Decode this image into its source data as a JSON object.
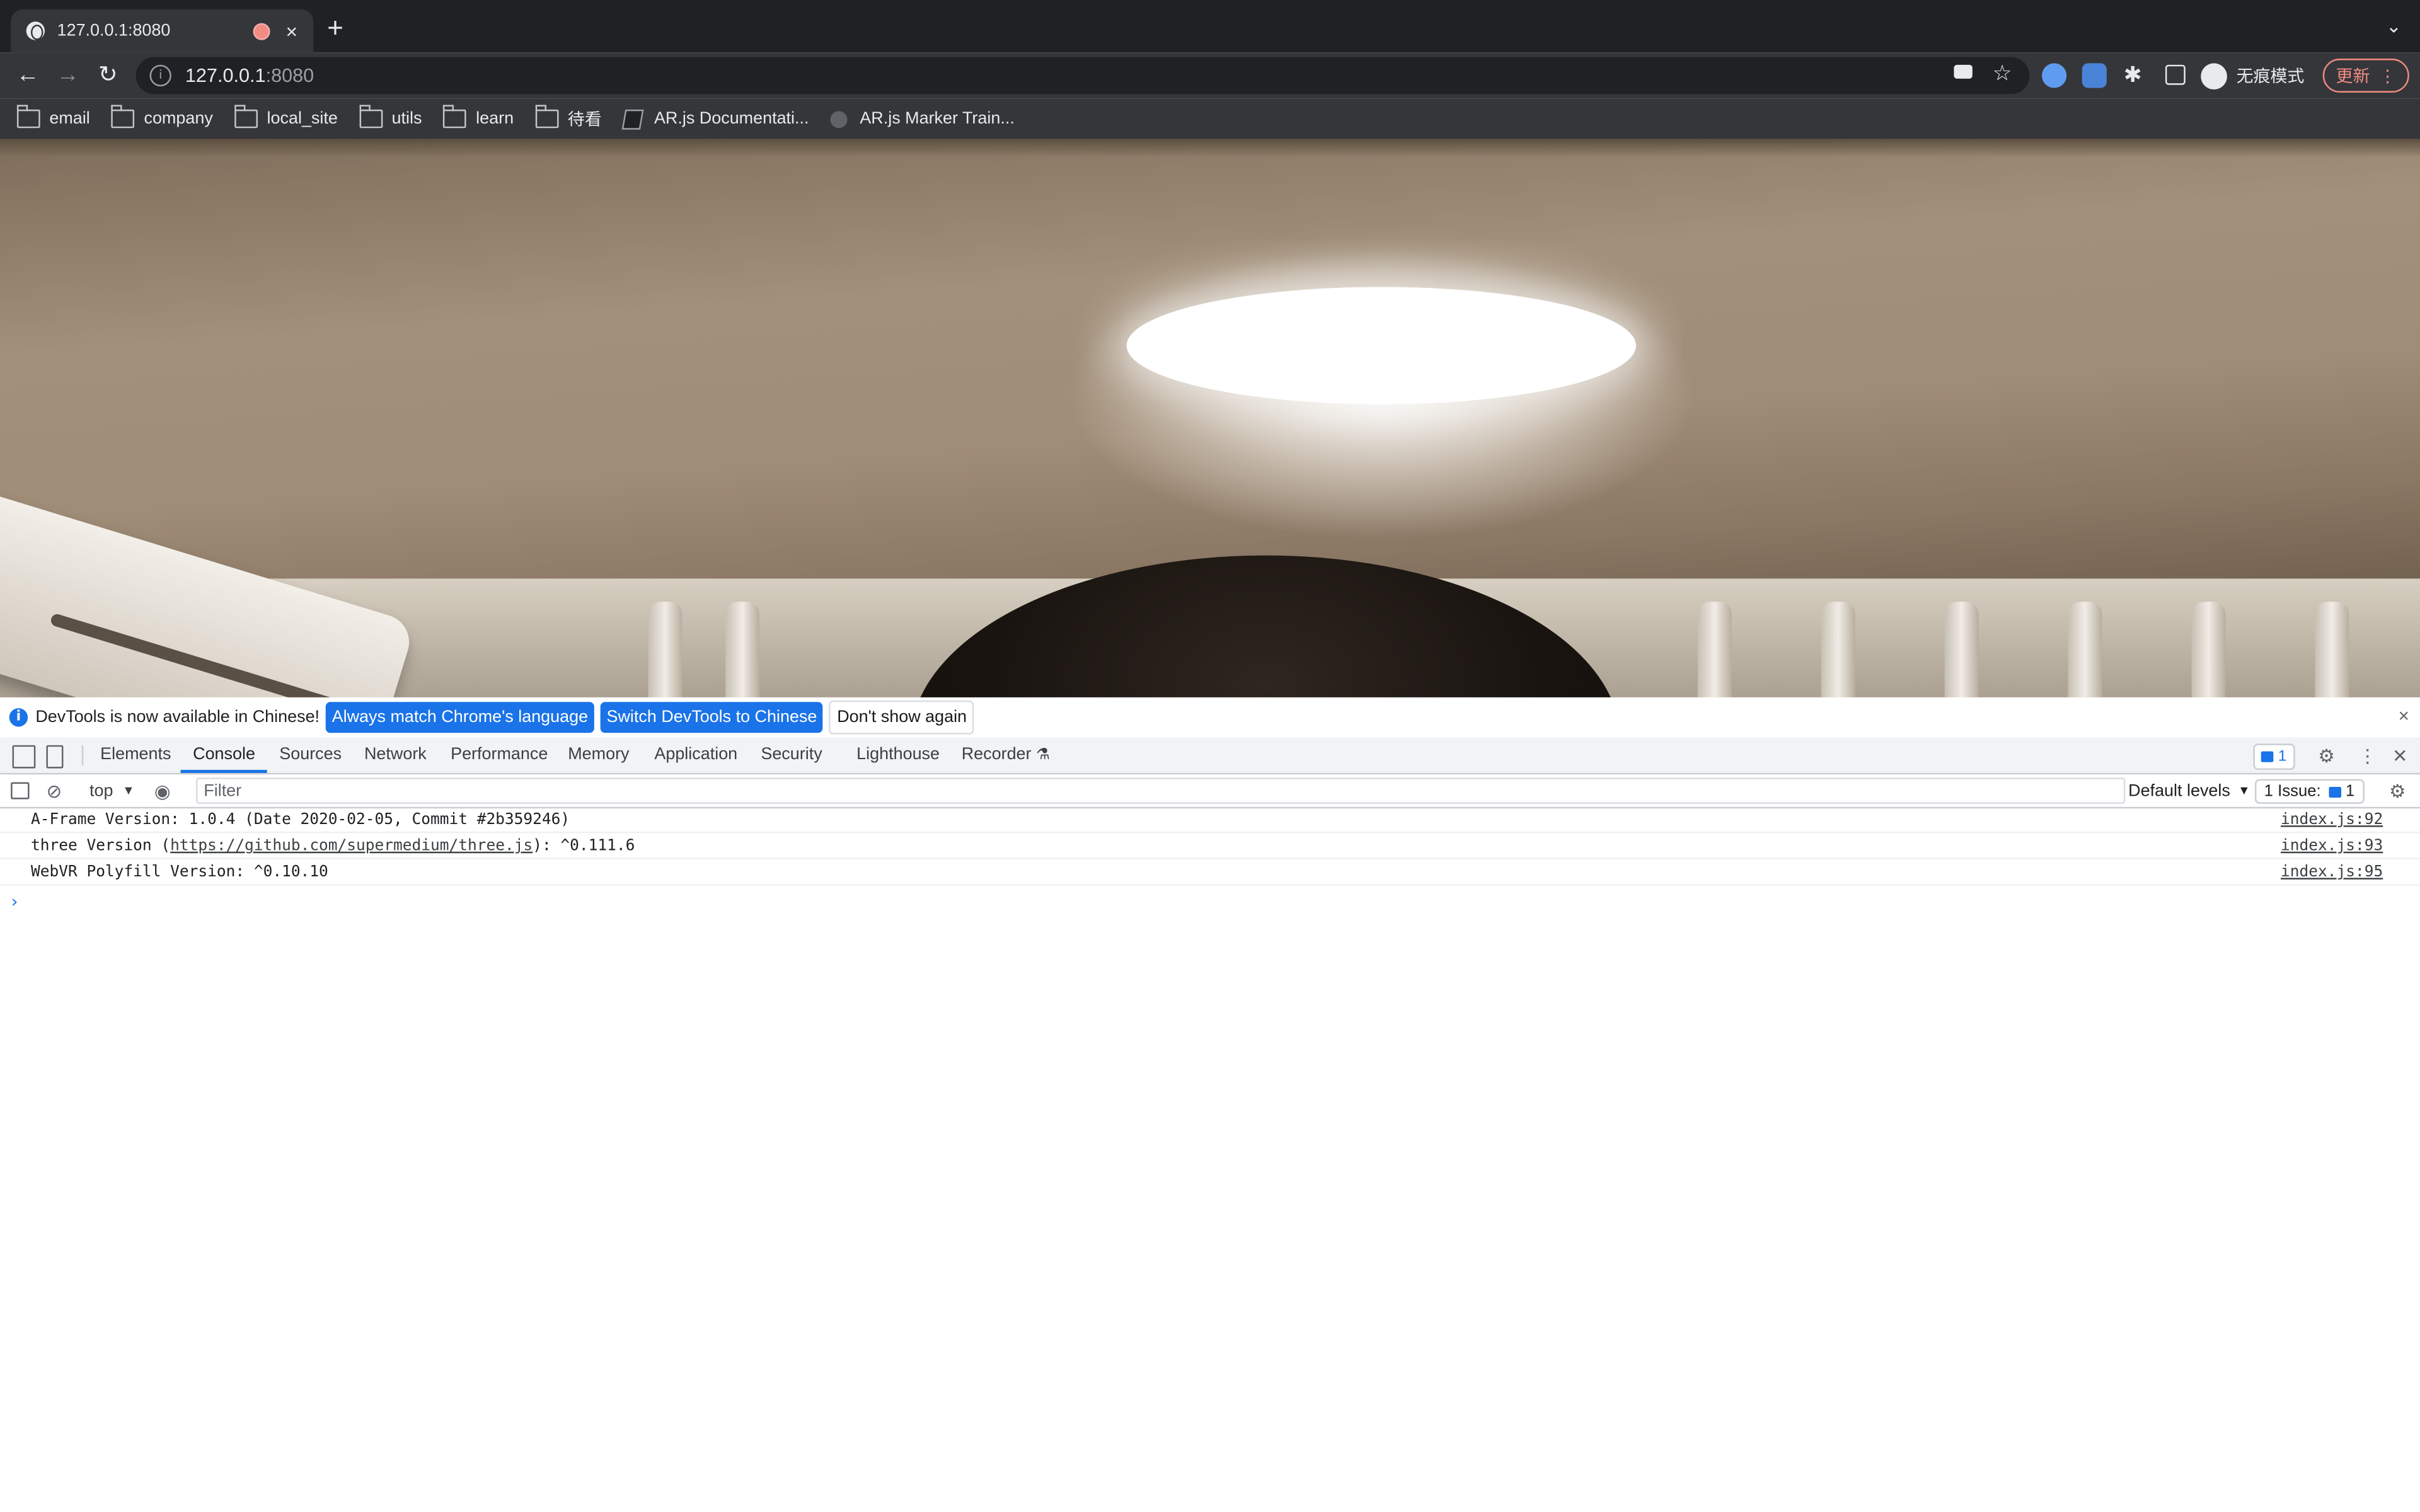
{
  "browser": {
    "tab_title": "127.0.0.1:8080",
    "tab_close": "×",
    "new_tab": "+",
    "tab_search": "⌄",
    "address": {
      "host": "127.0.0.1",
      "port": ":8080"
    },
    "profile_label": "无痕模式",
    "update_label": "更新",
    "bookmarks": [
      {
        "label": "email",
        "icon": "folder-icon"
      },
      {
        "label": "company",
        "icon": "folder-icon"
      },
      {
        "label": "local_site",
        "icon": "folder-icon"
      },
      {
        "label": "utils",
        "icon": "folder-icon"
      },
      {
        "label": "learn",
        "icon": "folder-icon"
      },
      {
        "label": "待看",
        "icon": "folder-icon"
      },
      {
        "label": "AR.js Documentati...",
        "icon": "book-icon"
      },
      {
        "label": "AR.js Marker Train...",
        "icon": "globe-icon"
      }
    ]
  },
  "devtools": {
    "infobar": {
      "message": "DevTools is now available in Chinese!",
      "btn_match": "Always match Chrome's language",
      "btn_switch": "Switch DevTools to Chinese",
      "btn_dismiss": "Don't show again",
      "close": "×"
    },
    "tabs": [
      "Elements",
      "Console",
      "Sources",
      "Network",
      "Performance",
      "Memory",
      "Application",
      "Security",
      "Lighthouse",
      "Recorder"
    ],
    "active_tab": "Console",
    "message_count": "1",
    "console": {
      "context": "top",
      "filter_placeholder": "Filter",
      "levels": "Default levels",
      "issues_label": "1 Issue:",
      "issues_count": "1",
      "logs": [
        {
          "pre": "A-Frame Version: 1.0.4 (Date 2020-02-05, Commit #2b359246)",
          "link": "",
          "post": "",
          "source": "index.js:92"
        },
        {
          "pre": "three Version (",
          "link": "https://github.com/supermedium/three.js",
          "post": "): ^0.111.6",
          "source": "index.js:93"
        },
        {
          "pre": "WebVR Polyfill Version: ^0.10.10",
          "link": "",
          "post": "",
          "source": "index.js:95"
        }
      ],
      "prompt": "›"
    }
  },
  "colors": {
    "chrome_dark": "#202124",
    "chrome_toolbar": "#35363a",
    "accent_blue": "#1a73e8",
    "update_red": "#f28b82"
  }
}
